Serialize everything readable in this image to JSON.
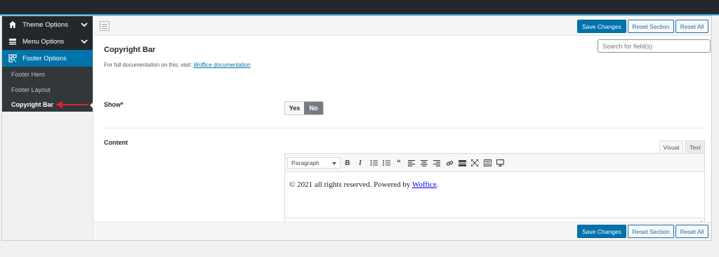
{
  "sidebar": {
    "menu": [
      {
        "label": "Theme Options",
        "icon": "home-icon"
      },
      {
        "label": "Menu Options",
        "icon": "menu-icon"
      },
      {
        "label": "Footer Options",
        "icon": "qr-grid-icon"
      }
    ],
    "submenu": [
      {
        "label": "Footer Hero"
      },
      {
        "label": "Footer Layout"
      },
      {
        "label": "Copyright Bar"
      }
    ]
  },
  "toolbar": {
    "save_label": "Save Changes",
    "reset_section_label": "Reset Section",
    "reset_all_label": "Reset All"
  },
  "search": {
    "placeholder": "Search for field(s)"
  },
  "section": {
    "title": "Copyright Bar",
    "doc_prefix": "For full documentation on this, visit:",
    "doc_link": "Woffice documentation"
  },
  "fields": {
    "show_label": "Show*",
    "yes_label": "Yes",
    "no_label": "No",
    "content_label": "Content"
  },
  "editor": {
    "tab_visual": "Visual",
    "tab_text": "Text",
    "format_value": "Paragraph",
    "body_text": "© 2021 all rights reserved. Powered by ",
    "body_link": "Woffice",
    "body_end": "."
  },
  "colors": {
    "accent": "#0073aa",
    "sidebar_bg": "#23282d",
    "annotation_arrow": "#e02424"
  }
}
